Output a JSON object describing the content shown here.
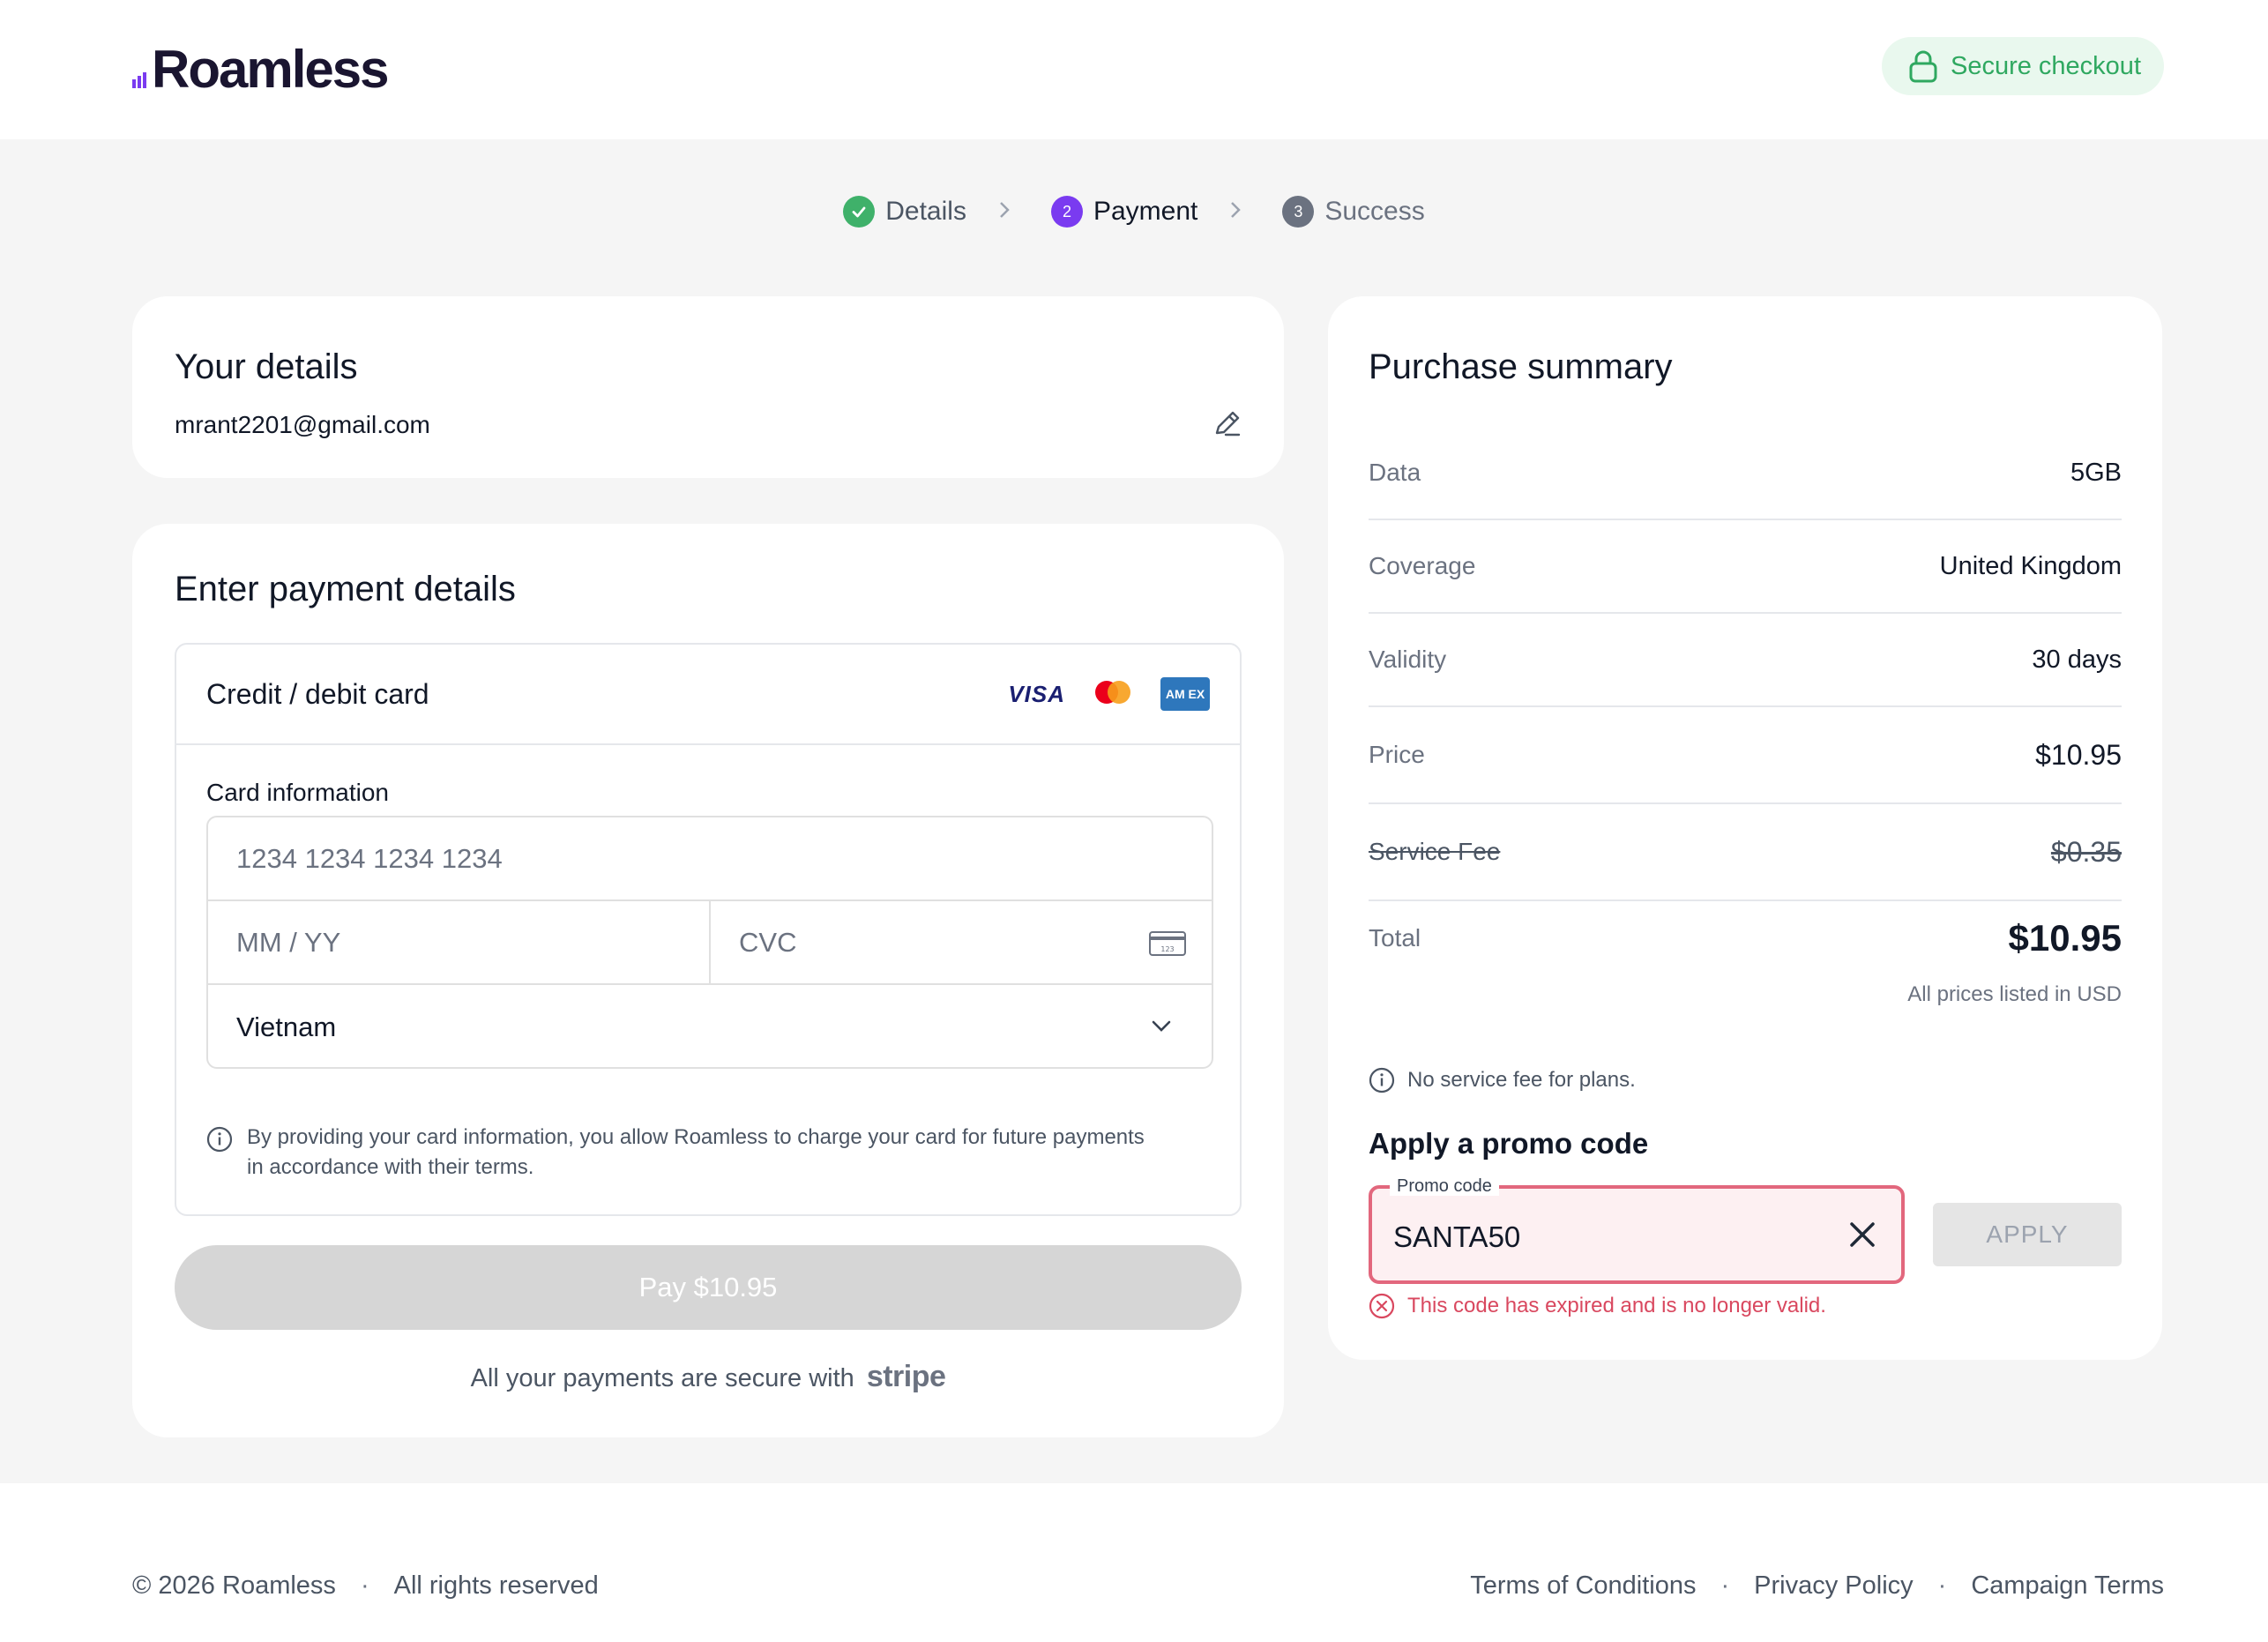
{
  "brand": {
    "name": "Roamless"
  },
  "header": {
    "secure_label": "Secure checkout"
  },
  "stepper": {
    "steps": [
      {
        "label": "Details",
        "marker": "",
        "state": "done"
      },
      {
        "label": "Payment",
        "marker": "2",
        "state": "active"
      },
      {
        "label": "Success",
        "marker": "3",
        "state": "pending"
      }
    ]
  },
  "details": {
    "title": "Your details",
    "email": "mrant2201@gmail.com"
  },
  "payment": {
    "title": "Enter payment details",
    "method_label": "Credit / debit card",
    "brands": {
      "visa": "VISA",
      "amex": "AM EX"
    },
    "card_info_label": "Card information",
    "card_number_placeholder": "1234 1234 1234 1234",
    "expiry_placeholder": "MM / YY",
    "cvc_placeholder": "CVC",
    "cvc_icon_text": "123",
    "country_value": "Vietnam",
    "consent_text": "By providing your card information, you allow Roamless to charge your card for future payments in accordance with their terms.",
    "pay_button_label": "Pay $10.95",
    "secure_text": "All your payments are secure with",
    "stripe_logo": "stripe"
  },
  "summary": {
    "title": "Purchase summary",
    "rows": [
      {
        "label": "Data",
        "value": "5GB"
      },
      {
        "label": "Coverage",
        "value": "United Kingdom"
      },
      {
        "label": "Validity",
        "value": "30 days"
      },
      {
        "label": "Price",
        "value": "$10.95"
      },
      {
        "label": "Service Fee",
        "value": "$0.35"
      }
    ],
    "total_label": "Total",
    "total_value": "$10.95",
    "currency_note": "All prices listed in USD",
    "no_fee_note": "No service fee for plans.",
    "promo_title": "Apply a promo code",
    "promo_legend": "Promo code",
    "promo_value": "SANTA50",
    "apply_label": "APPLY",
    "promo_error": "This code has expired and is no longer valid."
  },
  "footer": {
    "copyright": "© 2026 Roamless",
    "rights": "All rights reserved",
    "links": [
      "Terms of Conditions",
      "Privacy Policy",
      "Campaign Terms"
    ],
    "separator": "·"
  },
  "colors": {
    "accent": "#7a3bf0",
    "success": "#3fb16a",
    "error": "#d9485f",
    "secure_text": "#2fa860"
  }
}
